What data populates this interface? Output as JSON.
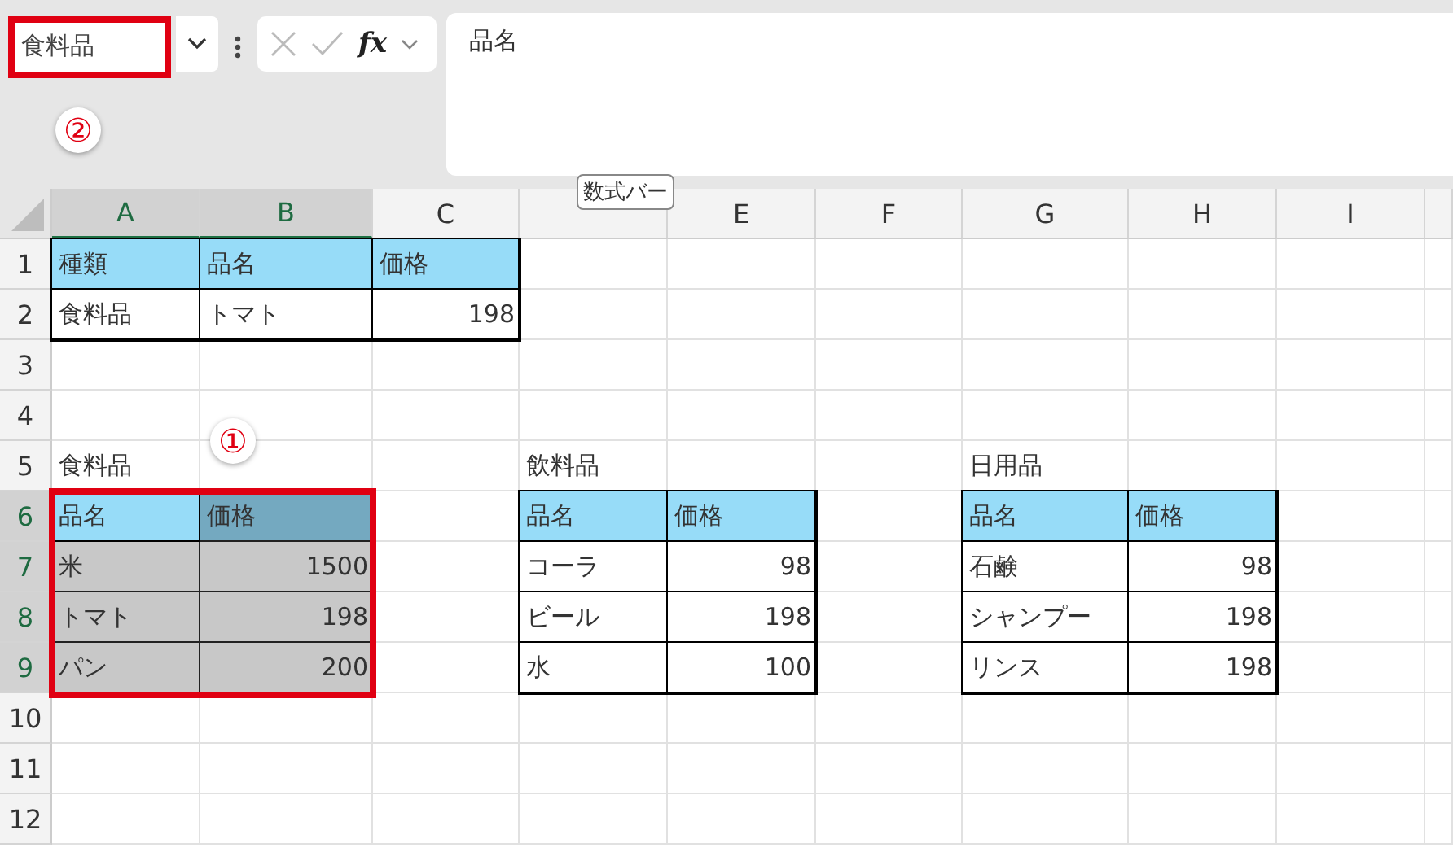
{
  "name_box": {
    "value": "食料品",
    "highlighted": true
  },
  "name_box_callout": "②",
  "function_button": "fx",
  "formula_bar": {
    "value": "品名"
  },
  "tooltip": "数式バー",
  "range_callout": "①",
  "columns": [
    {
      "label": "A",
      "selected": true
    },
    {
      "label": "B",
      "selected": true
    },
    {
      "label": "C",
      "selected": false
    },
    {
      "selected": false
    },
    {
      "label": "E",
      "selected": false
    },
    {
      "label": "F",
      "selected": false
    },
    {
      "label": "G",
      "selected": false
    },
    {
      "label": "H",
      "selected": false
    },
    {
      "label": "I",
      "selected": false
    }
  ],
  "rows": [
    {
      "label": "1",
      "selected": false,
      "cells": [
        {
          "text": "種類",
          "kind": "header",
          "selected": false
        },
        {
          "text": "品名",
          "kind": "header",
          "selected": false
        },
        {
          "text": "価格",
          "kind": "header",
          "selected": false
        },
        null,
        null,
        null,
        null,
        null,
        null
      ]
    },
    {
      "label": "2",
      "selected": false,
      "cells": [
        {
          "text": "食料品",
          "kind": "entry",
          "selected": false
        },
        {
          "text": "トマト",
          "kind": "entry",
          "selected": false
        },
        {
          "text": "198",
          "kind": "amount",
          "selected": false
        },
        null,
        null,
        null,
        null,
        null,
        null
      ]
    },
    {
      "label": "3",
      "selected": false,
      "cells": [
        null,
        null,
        null,
        null,
        null,
        null,
        null,
        null,
        null
      ]
    },
    {
      "label": "4",
      "selected": false,
      "cells": [
        null,
        null,
        null,
        null,
        null,
        null,
        null,
        null,
        null
      ]
    },
    {
      "label": "5",
      "selected": false,
      "cells": [
        {
          "text": "食料品",
          "kind": "label",
          "selected": false
        },
        null,
        null,
        {
          "text": "飲料品",
          "kind": "label",
          "selected": false
        },
        null,
        null,
        {
          "text": "日用品",
          "kind": "label",
          "selected": false
        },
        null,
        null
      ]
    },
    {
      "label": "6",
      "selected": true,
      "cells": [
        {
          "text": "品名",
          "kind": "header",
          "selected": false
        },
        {
          "text": "価格",
          "kind": "header",
          "selected": true
        },
        null,
        {
          "text": "品名",
          "kind": "header",
          "selected": false
        },
        {
          "text": "価格",
          "kind": "header",
          "selected": false
        },
        null,
        {
          "text": "品名",
          "kind": "header",
          "selected": false
        },
        {
          "text": "価格",
          "kind": "header",
          "selected": false
        },
        null
      ]
    },
    {
      "label": "7",
      "selected": true,
      "cells": [
        {
          "text": "米",
          "kind": "entry",
          "selected": true
        },
        {
          "text": "1500",
          "kind": "amount",
          "selected": true
        },
        null,
        {
          "text": "コーラ",
          "kind": "entry",
          "selected": false
        },
        {
          "text": "98",
          "kind": "amount",
          "selected": false
        },
        null,
        {
          "text": "石鹸",
          "kind": "entry",
          "selected": false
        },
        {
          "text": "98",
          "kind": "amount",
          "selected": false
        },
        null
      ]
    },
    {
      "label": "8",
      "selected": true,
      "cells": [
        {
          "text": "トマト",
          "kind": "entry",
          "selected": true
        },
        {
          "text": "198",
          "kind": "amount",
          "selected": true
        },
        null,
        {
          "text": "ビール",
          "kind": "entry",
          "selected": false
        },
        {
          "text": "198",
          "kind": "amount",
          "selected": false
        },
        null,
        {
          "text": "シャンプー",
          "kind": "entry",
          "selected": false
        },
        {
          "text": "198",
          "kind": "amount",
          "selected": false
        },
        null
      ]
    },
    {
      "label": "9",
      "selected": true,
      "cells": [
        {
          "text": "パン",
          "kind": "entry",
          "selected": true
        },
        {
          "text": "200",
          "kind": "amount",
          "selected": true
        },
        null,
        {
          "text": "水",
          "kind": "entry",
          "selected": false
        },
        {
          "text": "100",
          "kind": "amount",
          "selected": false
        },
        null,
        {
          "text": "リンス",
          "kind": "entry",
          "selected": false
        },
        {
          "text": "198",
          "kind": "amount",
          "selected": false
        },
        null
      ]
    },
    {
      "label": "10",
      "selected": false,
      "cells": [
        null,
        null,
        null,
        null,
        null,
        null,
        null,
        null,
        null
      ]
    },
    {
      "label": "11",
      "selected": false,
      "cells": [
        null,
        null,
        null,
        null,
        null,
        null,
        null,
        null,
        null
      ]
    },
    {
      "label": "12",
      "selected": false,
      "cells": [
        null,
        null,
        null,
        null,
        null,
        null,
        null,
        null,
        null
      ]
    }
  ]
}
